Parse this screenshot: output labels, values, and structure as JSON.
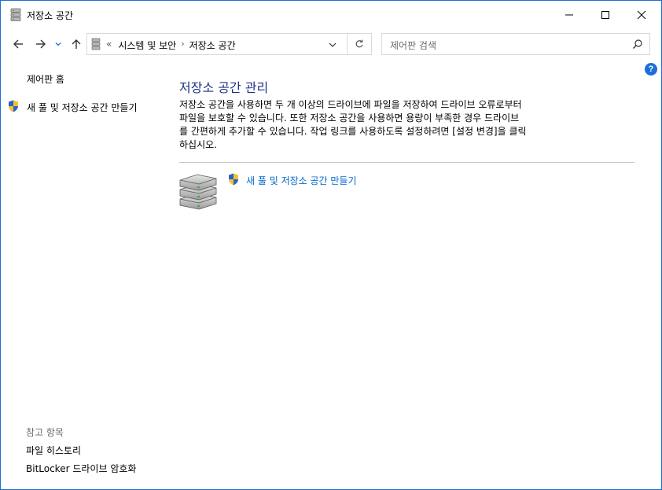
{
  "window": {
    "title": "저장소 공간",
    "icon": "storage-drive-icon",
    "controls": [
      "minimize-icon",
      "maximize-icon",
      "close-icon"
    ]
  },
  "navigation": {
    "back_icon": "back-arrow-icon",
    "forward_icon": "forward-arrow-icon",
    "recent_icon": "chevron-down-icon",
    "up_icon": "up-arrow-icon",
    "breadcrumb": {
      "overflow": "«",
      "items": [
        "시스템 및 보안",
        "저장소 공간"
      ],
      "separator": "›"
    },
    "refresh_icon": "refresh-icon",
    "search": {
      "placeholder": "제어판 검색",
      "value": ""
    }
  },
  "left_pane": {
    "home_link": "제어판 홈",
    "create_link": "새 풀 및 저장소 공간 만들기",
    "see_also": {
      "heading": "참고 항목",
      "links": [
        "파일 히스토리",
        "BitLocker 드라이브 암호화"
      ]
    }
  },
  "main": {
    "title": "저장소 공간 관리",
    "description": "저장소 공간을 사용하면 두 개 이상의 드라이브에 파일을 저장하여 드라이브 오류로부터 파일을 보호할 수 있습니다. 또한 저장소 공간을 사용하면 용량이 부족한 경우 드라이브를 간편하게 추가할 수 있습니다. 작업 링크를 사용하도록 설정하려면 [설정 변경]을 클릭하십시오.",
    "description_lines": [
      "저장소 공간을 사용하면 두 개 이상의 드라이브에 파일을 저장하여 드라이브 오류로부터",
      "파일을 보호할 수 있습니다. 또한 저장소 공간을 사용하면 용량이 부족한 경우 드라이브",
      "를 간편하게 추가할 수 있습니다. 작업 링크를 사용하도록 설정하려면 [설정 변경]을 클릭",
      "하십시오."
    ],
    "action_link": "새 풀 및 저장소 공간 만들기"
  },
  "help_label": "?",
  "colors": {
    "title_blue": "#1e3287",
    "link_blue": "#0066cc",
    "window_border": "#1a6fd9",
    "muted_text": "#6d6d6d"
  }
}
